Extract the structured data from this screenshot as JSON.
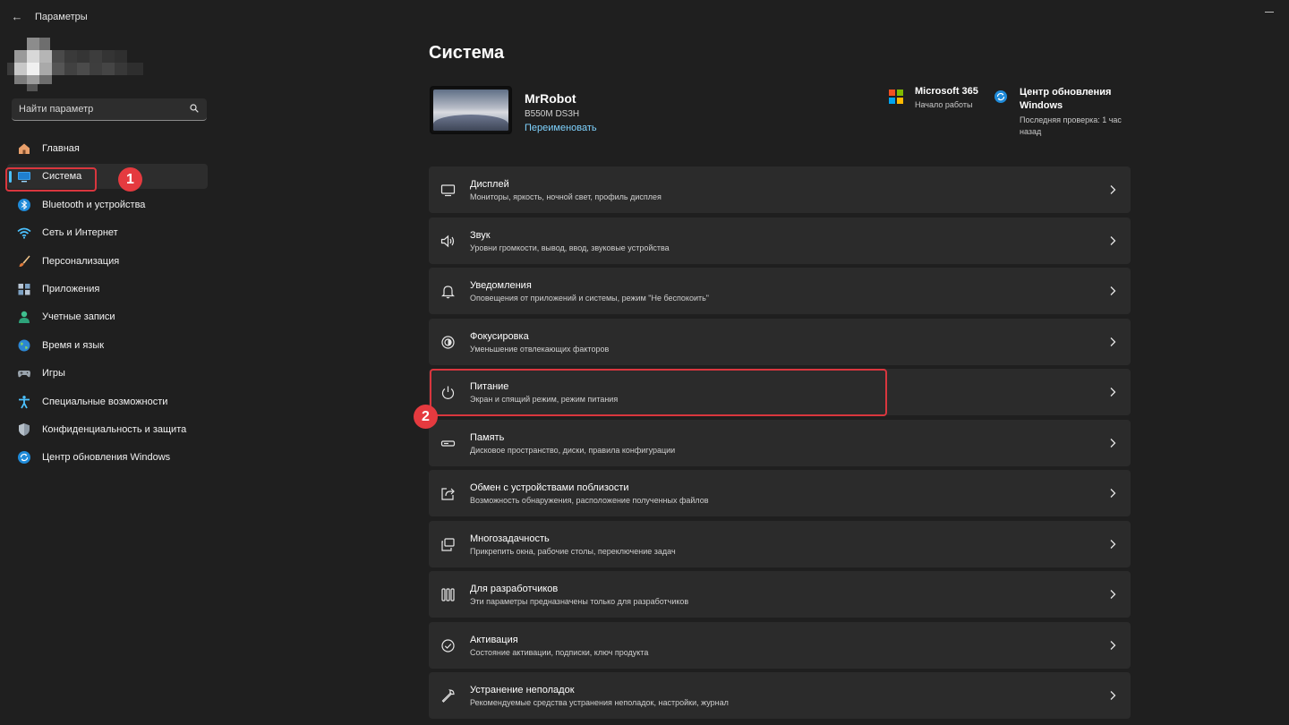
{
  "window": {
    "title": "Параметры"
  },
  "sidebar": {
    "search_placeholder": "Найти параметр",
    "items": [
      {
        "label": "Главная",
        "icon": "home-icon"
      },
      {
        "label": "Система",
        "icon": "system-icon",
        "selected": true
      },
      {
        "label": "Bluetooth и устройства",
        "icon": "bluetooth-icon"
      },
      {
        "label": "Сеть и Интернет",
        "icon": "wifi-icon"
      },
      {
        "label": "Персонализация",
        "icon": "brush-icon"
      },
      {
        "label": "Приложения",
        "icon": "apps-icon"
      },
      {
        "label": "Учетные записи",
        "icon": "account-icon"
      },
      {
        "label": "Время и язык",
        "icon": "globe-icon"
      },
      {
        "label": "Игры",
        "icon": "gamepad-icon"
      },
      {
        "label": "Специальные возможности",
        "icon": "accessibility-icon"
      },
      {
        "label": "Конфиденциальность и защита",
        "icon": "shield-icon"
      },
      {
        "label": "Центр обновления Windows",
        "icon": "update-icon"
      }
    ]
  },
  "main": {
    "title": "Система",
    "device": {
      "name": "MrRobot",
      "model": "B550M DS3H",
      "rename": "Переименовать"
    },
    "ms365": {
      "title": "Microsoft 365",
      "subtitle": "Начало работы"
    },
    "update": {
      "title": "Центр обновления Windows",
      "subtitle": "Последняя проверка: 1 час назад"
    },
    "cards": [
      {
        "title": "Дисплей",
        "subtitle": "Мониторы, яркость, ночной свет, профиль дисплея",
        "icon": "display-icon"
      },
      {
        "title": "Звук",
        "subtitle": "Уровни громкости, вывод, ввод, звуковые устройства",
        "icon": "speaker-icon"
      },
      {
        "title": "Уведомления",
        "subtitle": "Оповещения от приложений и системы, режим \"Не беспокоить\"",
        "icon": "bell-icon"
      },
      {
        "title": "Фокусировка",
        "subtitle": "Уменьшение отвлекающих факторов",
        "icon": "focus-icon"
      },
      {
        "title": "Питание",
        "subtitle": "Экран и спящий режим, режим питания",
        "icon": "power-icon"
      },
      {
        "title": "Память",
        "subtitle": "Дисковое пространство, диски, правила конфигурации",
        "icon": "storage-icon"
      },
      {
        "title": "Обмен с устройствами поблизости",
        "subtitle": "Возможность обнаружения, расположение полученных файлов",
        "icon": "share-icon"
      },
      {
        "title": "Многозадачность",
        "subtitle": "Прикрепить окна, рабочие столы, переключение задач",
        "icon": "multitask-icon"
      },
      {
        "title": "Для разработчиков",
        "subtitle": "Эти параметры предназначены только для разработчиков",
        "icon": "developer-icon"
      },
      {
        "title": "Активация",
        "subtitle": "Состояние активации, подписки, ключ продукта",
        "icon": "activation-icon"
      },
      {
        "title": "Устранение неполадок",
        "subtitle": "Рекомендуемые средства устранения неполадок, настройки, журнал",
        "icon": "wrench-icon"
      }
    ]
  },
  "annotations": {
    "badge_1": "1",
    "badge_2": "2"
  },
  "colors": {
    "accent": "#4cc2ff",
    "highlight": "#d9363e",
    "card_bg": "#2b2b2b",
    "window_bg": "#1f1f1f"
  }
}
